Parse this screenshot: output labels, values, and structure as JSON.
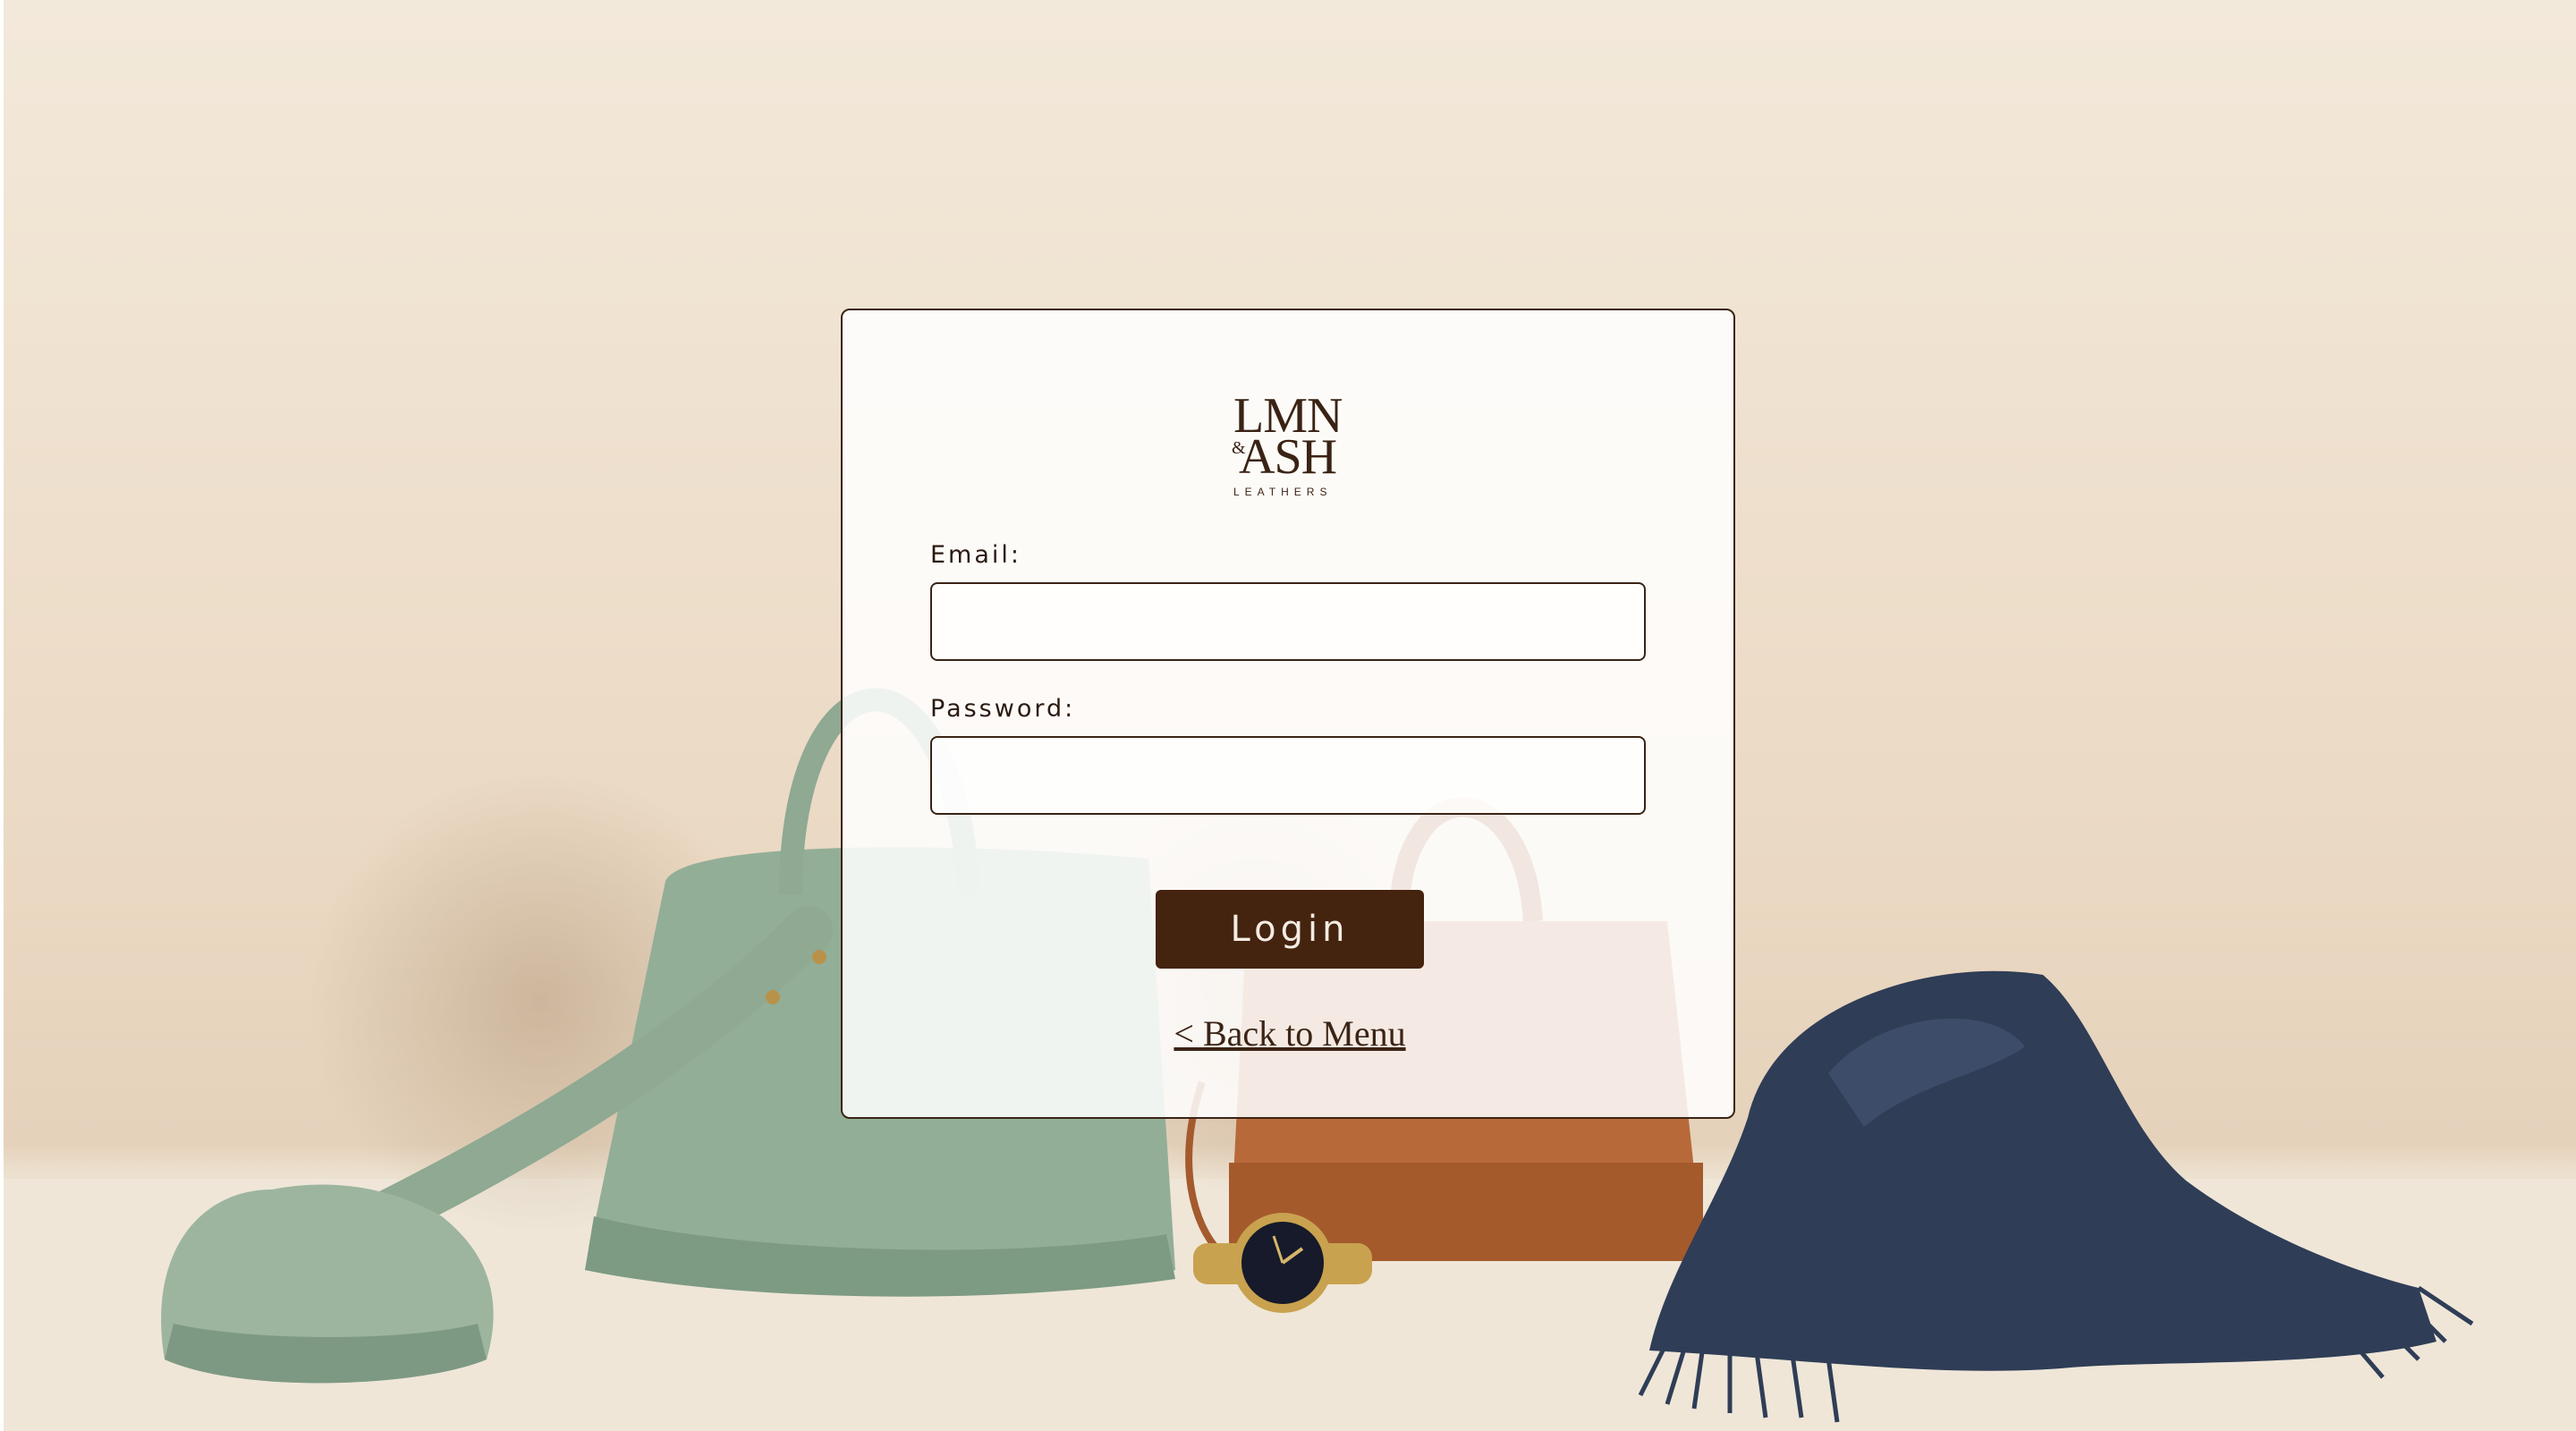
{
  "brand": {
    "logo_line1": "LMN",
    "logo_ampersand": "&",
    "logo_line2": "ASH",
    "logo_sub": "LEATHERS"
  },
  "form": {
    "email_label": "Email:",
    "email_value": "",
    "password_label": "Password:",
    "password_value": "",
    "login_label": "Login",
    "back_link": "< Back to Menu"
  },
  "background": {
    "description_items": [
      "green-handbag-icon",
      "brown-handbag-icon",
      "wristwatch-icon",
      "navy-scarf-icon"
    ]
  },
  "colors": {
    "accent": "#44230f",
    "border": "#3b2415",
    "text": "#2b1a10",
    "background": "#efe1cf"
  }
}
